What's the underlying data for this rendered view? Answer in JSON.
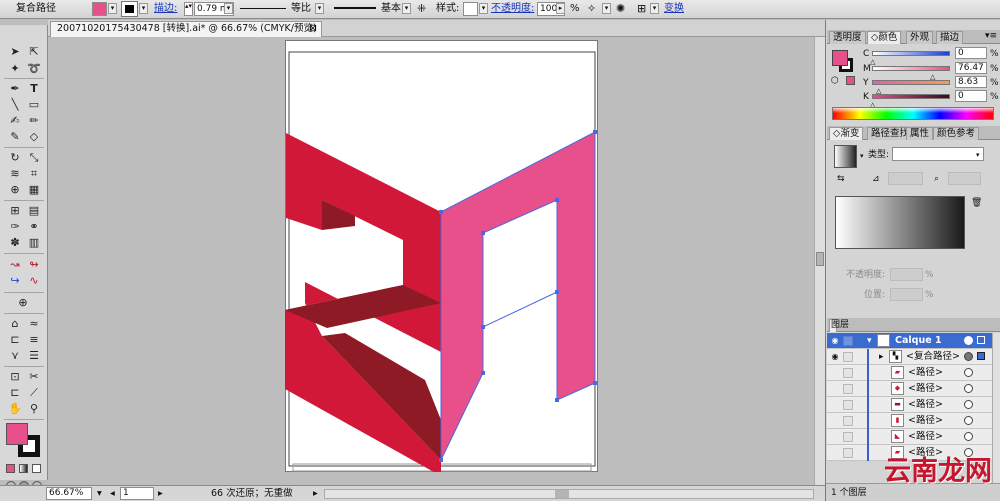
{
  "control_bar": {
    "object_type": "复合路径",
    "stroke_label": "描边:",
    "stroke_weight": "0.79 m",
    "profile_label": "等比",
    "brush_label": "基本",
    "style_label": "样式:",
    "opacity_label": "不透明度:",
    "opacity_value": "100",
    "opacity_unit": "%",
    "transform_label": "变换",
    "fill_color": "#e8508b"
  },
  "document": {
    "tab_title": "20071020175430478 [转换].ai* @ 66.67% (CMYK/预览)",
    "close_glyph": "⊠"
  },
  "artwork": {
    "colors": {
      "red_face": "#d21838",
      "red_shadow": "#8d1a24",
      "pink_face": "#e8508b",
      "selection": "#4a68e0"
    }
  },
  "color_panel": {
    "tabs": [
      "透明度",
      "颜色",
      "外观",
      "描边"
    ],
    "channels": [
      {
        "label": "C",
        "value": "0"
      },
      {
        "label": "M",
        "value": "76.47"
      },
      {
        "label": "Y",
        "value": "8.63"
      },
      {
        "label": "K",
        "value": "0"
      }
    ],
    "unit": "%"
  },
  "gradient_panel": {
    "tabs": [
      "渐变",
      "路径查找",
      "属性",
      "颜色参考"
    ],
    "type_label": "类型:",
    "opacity_label": "不透明度:",
    "location_label": "位置:",
    "unit": "%"
  },
  "layers_panel": {
    "tab": "图层",
    "layer_name": "Calque 1",
    "rows": [
      "<复合路径>",
      "<路径>",
      "<路径>",
      "<路径>",
      "<路径>",
      "<路径>",
      "<路径>"
    ],
    "footer": "1 个图层"
  },
  "status_bar": {
    "zoom": "66.67%",
    "page": "1",
    "undo_text": "66 次还原；无重做"
  },
  "watermark": "云南龙网"
}
